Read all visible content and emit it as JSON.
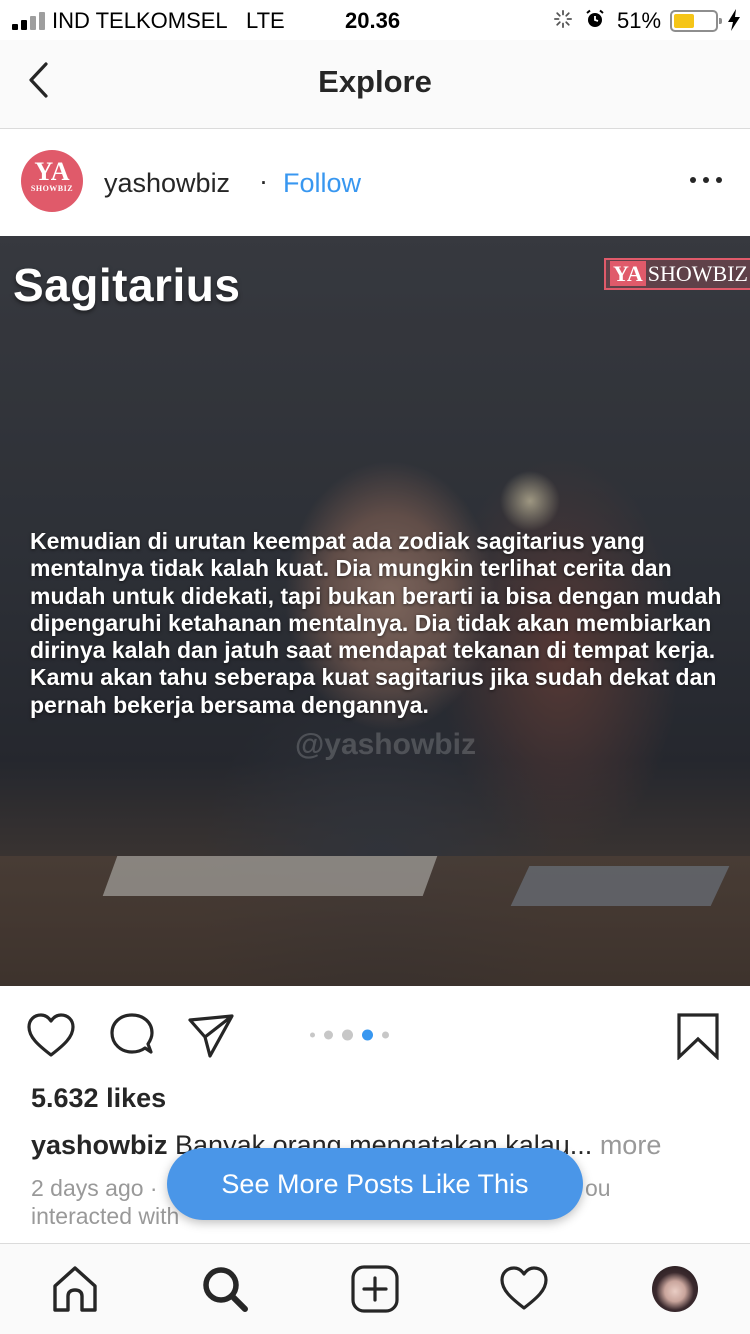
{
  "status_bar": {
    "carrier": "IND TELKOMSEL",
    "network": "LTE",
    "time": "20.36",
    "battery_percent": "51%",
    "battery_level": 0.51
  },
  "nav": {
    "title": "Explore",
    "back_icon": "chevron-left-icon"
  },
  "post": {
    "username": "yashowbiz",
    "separator": "·",
    "follow_label": "Follow",
    "avatar": {
      "line1": "YA",
      "line2": "SHOWBIZ"
    },
    "image": {
      "title": "Sagitarius",
      "logo_ya": "YA",
      "logo_showbiz": "SHOWBIZ",
      "body_text": "Kemudian di urutan keempat ada zodiak sagitarius yang mentalnya tidak kalah kuat. Dia mungkin terlihat cerita dan mudah untuk didekati, tapi bukan berarti ia bisa dengan mudah dipengaruhi ketahanan mentalnya. Dia tidak akan membiarkan dirinya kalah dan jatuh saat mendapat tekanan di tempat kerja. Kamu akan tahu seberapa kuat sagitarius jika sudah dekat dan pernah bekerja bersama dengannya.",
      "watermark": "@yashowbiz"
    },
    "carousel": {
      "total": 5,
      "active_index": 3
    },
    "likes": "5.632 likes",
    "caption_user": "yashowbiz",
    "caption_text": " Banyak orang mengatakan kalau...",
    "caption_more": " more",
    "time_ago": "2 days ago ·",
    "meta_suffix": "ou",
    "meta_line2": "interacted with"
  },
  "see_more_button": "See More Posts Like This",
  "tabbar": {
    "items": [
      "home-icon",
      "search-icon",
      "add-icon",
      "heart-icon",
      "profile-avatar"
    ]
  },
  "colors": {
    "accent": "#3897f0",
    "button": "#4a96e8",
    "brand": "#e05a6a",
    "battery": "#f5c518"
  }
}
